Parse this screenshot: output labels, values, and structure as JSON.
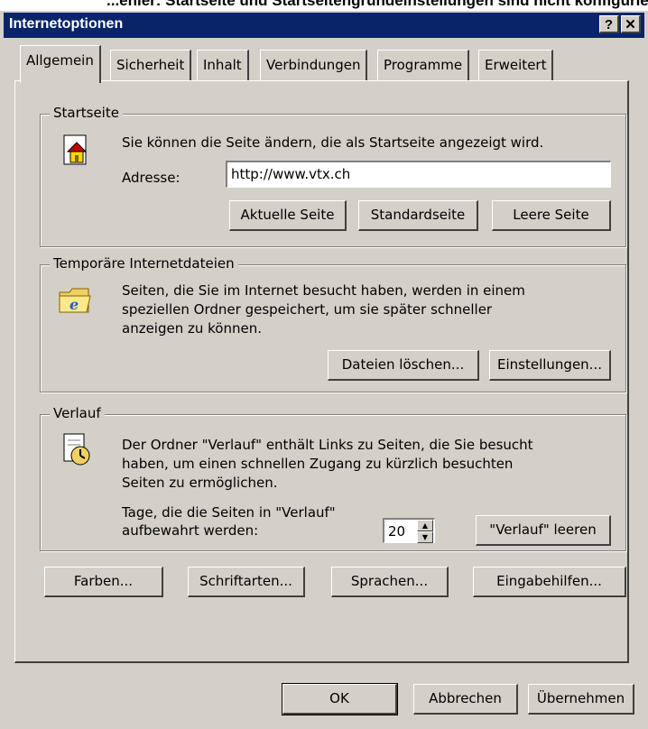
{
  "background_caption": "...ehler: Startseite und Startseitengrundeinstellungen sind nicht konfigurierbar...",
  "window": {
    "title": "Internetoptionen",
    "help_button": "?",
    "close_button": "✕"
  },
  "tabs": [
    {
      "label": "Allgemein",
      "active": true
    },
    {
      "label": "Sicherheit",
      "active": false
    },
    {
      "label": "Inhalt",
      "active": false
    },
    {
      "label": "Verbindungen",
      "active": false
    },
    {
      "label": "Programme",
      "active": false
    },
    {
      "label": "Erweitert",
      "active": false
    }
  ],
  "startseite": {
    "legend": "Startseite",
    "description": "Sie können die Seite ändern, die als Startseite angezeigt wird.",
    "address_label": "Adresse:",
    "address_value": "http://www.vtx.ch",
    "btn_current": "Aktuelle Seite",
    "btn_default": "Standardseite",
    "btn_blank": "Leere Seite"
  },
  "temp": {
    "legend": "Temporäre Internetdateien",
    "line1": "Seiten, die Sie im Internet besucht haben, werden in einem",
    "line2": "speziellen Ordner gespeichert, um sie später schneller",
    "line3": "anzeigen zu können.",
    "btn_delete": "Dateien löschen...",
    "btn_settings": "Einstellungen..."
  },
  "verlauf": {
    "legend": "Verlauf",
    "line1": "Der Ordner \"Verlauf\" enthält Links zu Seiten, die Sie besucht",
    "line2": "haben, um einen schnellen Zugang zu kürzlich besuchten",
    "line3": "Seiten zu ermöglichen.",
    "days_label1": "Tage, die die Seiten in \"Verlauf\"",
    "days_label2": "aufbewahrt werden:",
    "days_value": "20",
    "btn_clear": "\"Verlauf\" leeren"
  },
  "bottom_buttons": {
    "colors": "Farben...",
    "fonts": "Schriftarten...",
    "languages": "Sprachen...",
    "accessibility": "Eingabehilfen..."
  },
  "dialog_buttons": {
    "ok": "OK",
    "cancel": "Abbrechen",
    "apply": "Übernehmen"
  }
}
